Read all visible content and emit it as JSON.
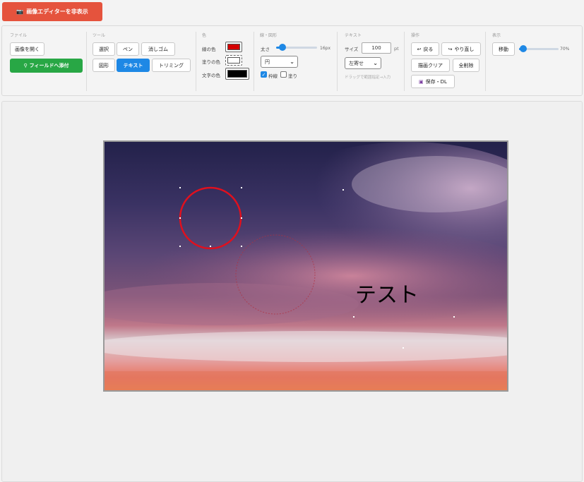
{
  "toggle": {
    "label": "画像エディターを非表示",
    "icon": "camera-icon"
  },
  "file": {
    "title": "ファイル",
    "open_label": "画像を開く",
    "attach_label": "フィールドへ添付"
  },
  "tools": {
    "title": "ツール",
    "select": "選択",
    "pen": "ペン",
    "eraser": "消しゴム",
    "shape": "図形",
    "text": "テキスト",
    "trim": "トリミング",
    "active": "テキスト"
  },
  "color": {
    "title": "色",
    "line_label": "線の色",
    "line_color": "#d40000",
    "fill_label": "塗りの色",
    "fill_color": "#ffffff",
    "text_label": "文字の色",
    "text_color": "#000000"
  },
  "shape": {
    "title": "線・図形",
    "width_label": "太さ",
    "width_value": "16px",
    "width_fraction": 0.16,
    "shape_select": "円",
    "stroke_label": "枠線",
    "stroke_checked": true,
    "fill_label": "塗り",
    "fill_checked": false
  },
  "text": {
    "title": "テキスト",
    "size_label": "サイズ",
    "size_value": "100",
    "size_unit": "pt",
    "align_select": "左寄せ",
    "hint": "ドラッグで範囲指定→入力"
  },
  "ops": {
    "title": "操作",
    "undo": "戻る",
    "redo": "やり直し",
    "clear": "描画クリア",
    "delete_all": "全削除",
    "save": "保存・DL"
  },
  "view": {
    "title": "表示",
    "move": "移動",
    "zoom_value": "70%",
    "zoom_fraction": 0.1
  },
  "canvas": {
    "overlay_text": "テスト"
  }
}
